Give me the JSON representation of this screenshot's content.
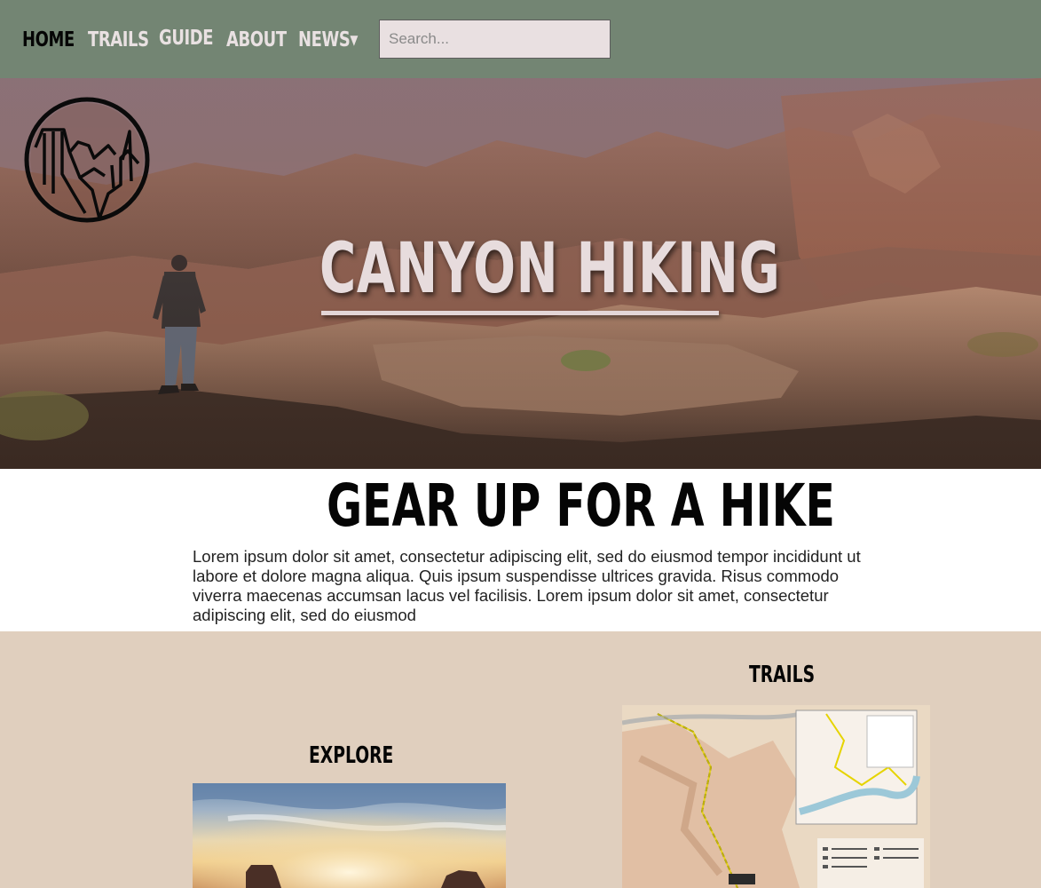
{
  "nav": {
    "items": [
      {
        "label": "Home",
        "active": true
      },
      {
        "label": "Trails",
        "active": false
      },
      {
        "label": "Guide",
        "active": false
      },
      {
        "label": "About",
        "active": false
      },
      {
        "label": "News▾",
        "active": false
      }
    ],
    "search_placeholder": "Search..."
  },
  "hero": {
    "title": "Canyon Hiking",
    "logo_icon": "canyon-logo-icon"
  },
  "intro": {
    "heading": "Gear up for a hike",
    "body": "Lorem ipsum dolor sit amet, consectetur adipiscing elit, sed do eiusmod tempor incididunt ut labore et dolore magna aliqua. Quis ipsum suspendisse ultrices gravida. Risus commodo viverra maecenas accumsan lacus vel facilisis. Lorem ipsum dolor sit amet, consectetur adipiscing elit, sed do eiusmod"
  },
  "sections": {
    "explore_heading": "Explore",
    "trails_heading": "Trails"
  },
  "colors": {
    "nav_bg": "#738573",
    "nav_text": "#e9e1e2",
    "nav_active": "#050505",
    "lower_bg": "#e0cfbe"
  }
}
